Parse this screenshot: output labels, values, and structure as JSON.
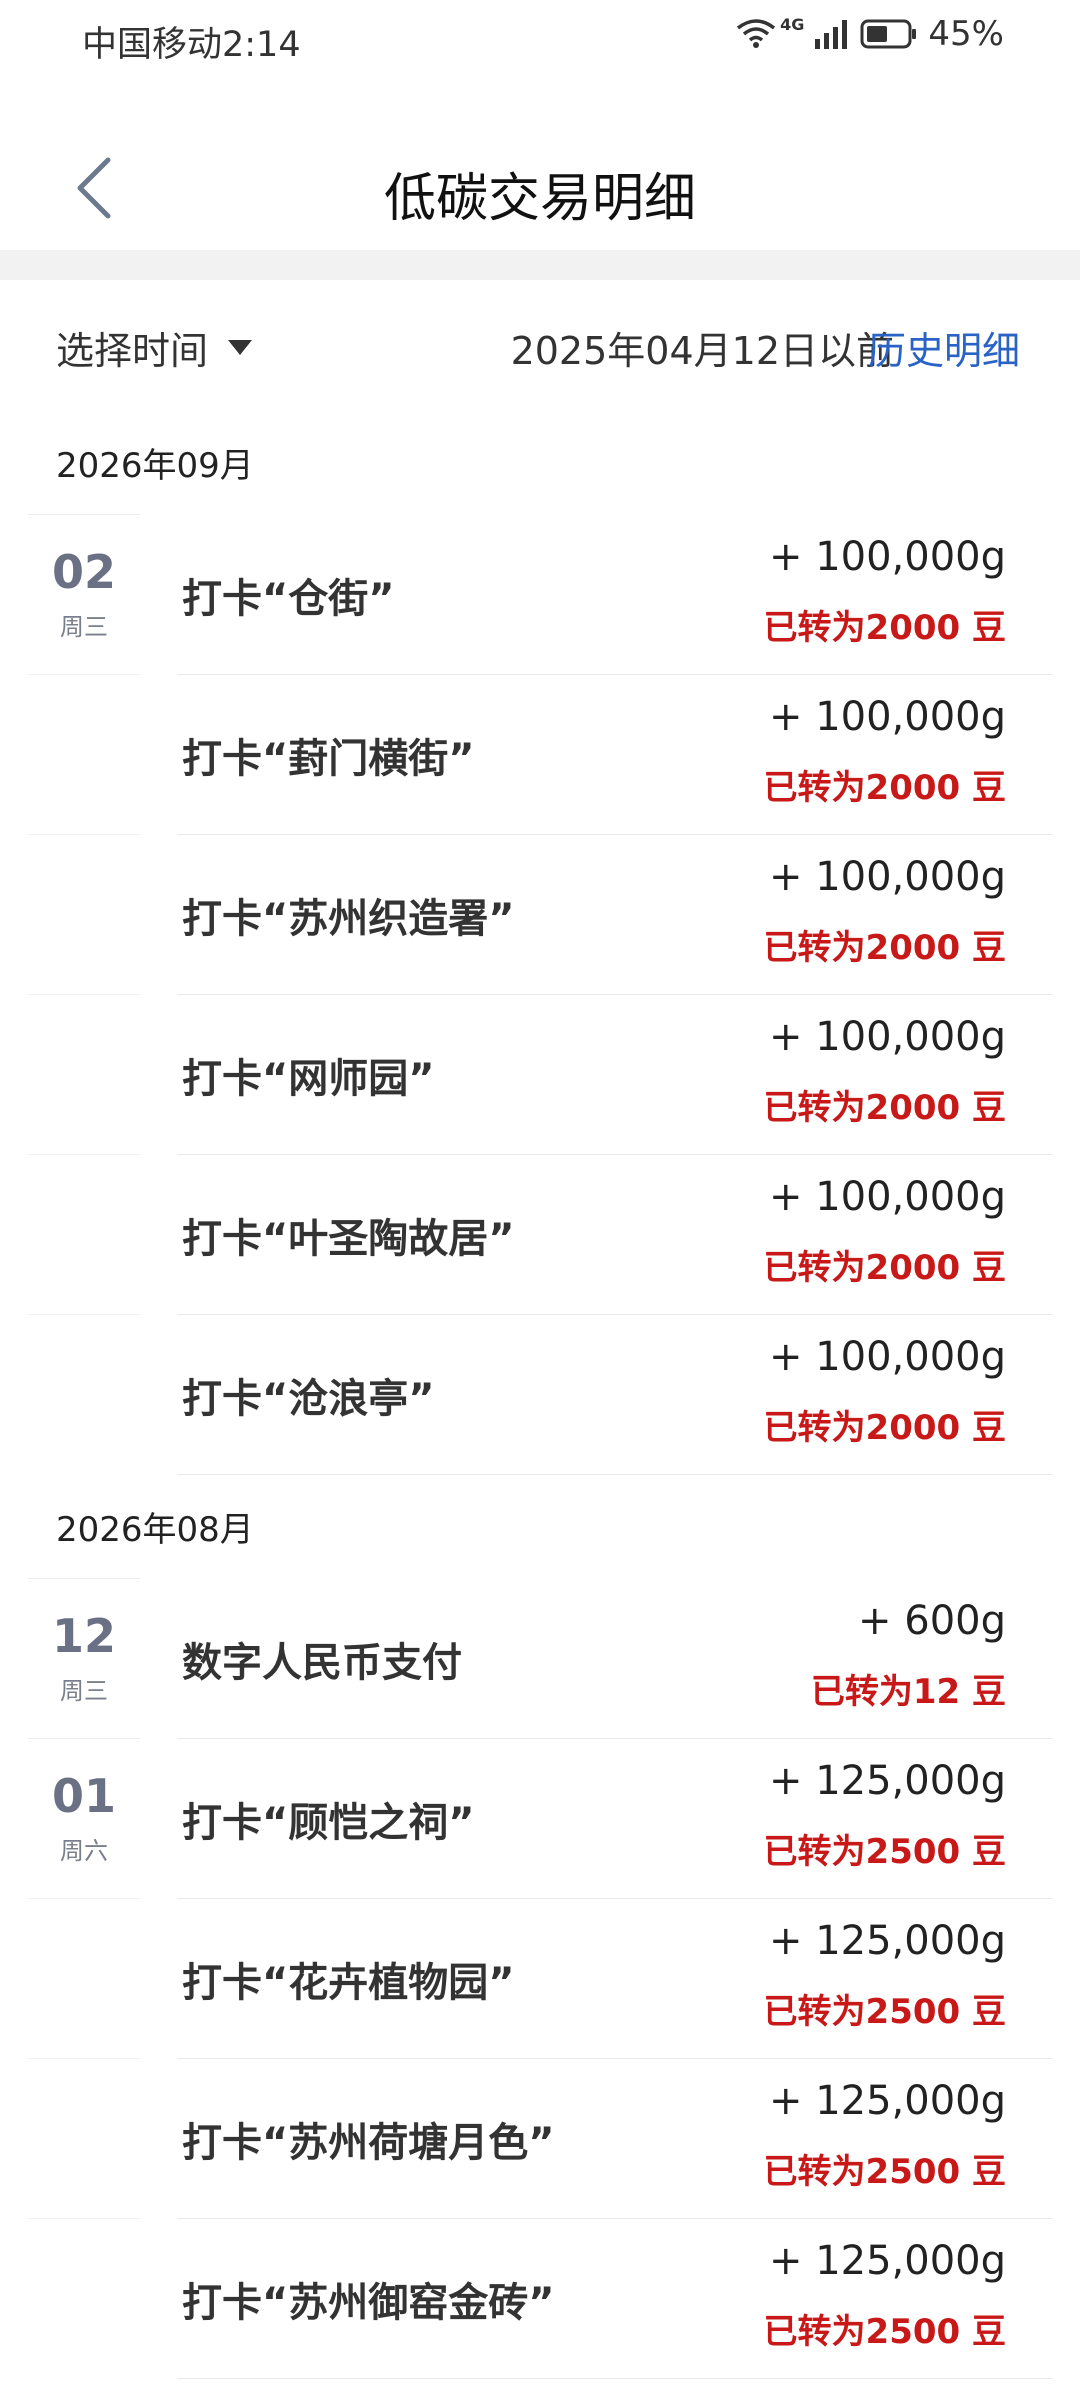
{
  "status": {
    "carrier_time": "中国移动2:14",
    "signal_label": "4G",
    "battery": "45%"
  },
  "header": {
    "title": "低碳交易明细"
  },
  "filter": {
    "select_time": "选择时间",
    "before_date": "2025年04月12日以前",
    "history_link": "历史明细"
  },
  "groups": [
    {
      "month": "2026年09月",
      "items": [
        {
          "day": "02",
          "weekday": "周三",
          "name": "打卡“仓街”",
          "amount": "+ 100,000g",
          "converted": "已转为2000 豆"
        },
        {
          "name": "打卡“葑门横街”",
          "amount": "+ 100,000g",
          "converted": "已转为2000 豆"
        },
        {
          "name": "打卡“苏州织造署”",
          "amount": "+ 100,000g",
          "converted": "已转为2000 豆"
        },
        {
          "name": "打卡“网师园”",
          "amount": "+ 100,000g",
          "converted": "已转为2000 豆"
        },
        {
          "name": "打卡“叶圣陶故居”",
          "amount": "+ 100,000g",
          "converted": "已转为2000 豆"
        },
        {
          "name": "打卡“沧浪亭”",
          "amount": "+ 100,000g",
          "converted": "已转为2000 豆"
        }
      ]
    },
    {
      "month": "2026年08月",
      "items": [
        {
          "day": "12",
          "weekday": "周三",
          "name": "数字人民币支付",
          "amount": "+ 600g",
          "converted": "已转为12 豆"
        },
        {
          "day": "01",
          "weekday": "周六",
          "name": "打卡“顾恺之祠”",
          "amount": "+ 125,000g",
          "converted": "已转为2500 豆"
        },
        {
          "name": "打卡“花卉植物园”",
          "amount": "+ 125,000g",
          "converted": "已转为2500 豆"
        },
        {
          "name": "打卡“苏州荷塘月色”",
          "amount": "+ 125,000g",
          "converted": "已转为2500 豆"
        },
        {
          "name": "打卡“苏州御窑金砖”",
          "amount": "+ 125,000g",
          "converted": "已转为2500 豆"
        }
      ]
    }
  ],
  "colors": {
    "accent_link": "#2a63c6",
    "converted_red": "#c81818",
    "day_gray": "#6a7185"
  },
  "icons": {
    "back": "chevron-left-icon",
    "dropdown": "caret-down-icon",
    "wifi": "wifi-icon",
    "signal": "signal-icon",
    "battery": "battery-icon"
  }
}
